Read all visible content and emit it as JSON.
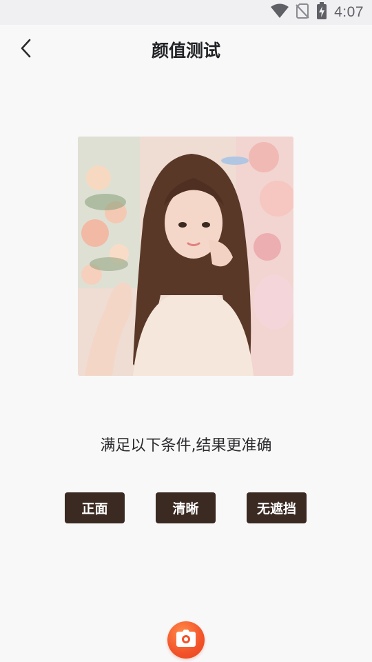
{
  "status_bar": {
    "time": "4:07",
    "icons": [
      "wifi-icon",
      "no-sim-icon",
      "battery-charging-icon"
    ]
  },
  "header": {
    "back_icon": "chevron-left-icon",
    "title": "颜值测试"
  },
  "photo": {
    "subject": "portrait photo"
  },
  "hint": "满足以下条件,结果更准确",
  "conditions": [
    "正面",
    "清晰",
    "无遮挡"
  ],
  "camera_button": {
    "icon": "camera-icon"
  },
  "colors": {
    "background": "#f8f8f9",
    "tag_background": "#3a2a22",
    "camera_button": "#f2532a"
  }
}
